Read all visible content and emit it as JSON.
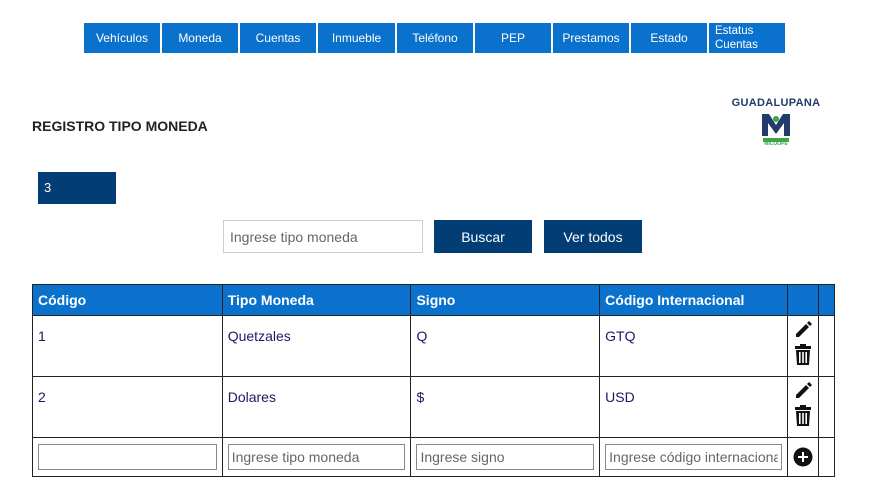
{
  "nav": {
    "items": [
      {
        "label": "Vehículos"
      },
      {
        "label": "Moneda"
      },
      {
        "label": "Cuentas"
      },
      {
        "label": "Inmueble"
      },
      {
        "label": "Teléfono"
      },
      {
        "label": "PEP"
      },
      {
        "label": "Prestamos"
      },
      {
        "label": "Estado"
      },
      {
        "label_line1": "Estatus",
        "label_line2": "Cuentas"
      }
    ]
  },
  "page": {
    "title": "REGISTRO TIPO MONEDA"
  },
  "logo": {
    "text": "GUADALUPANA",
    "subtext": "MICOOPE",
    "icon": "m-logo-icon"
  },
  "counter": {
    "value": "3"
  },
  "search": {
    "placeholder": "Ingrese tipo moneda",
    "button_label": "Buscar",
    "view_all_label": "Ver todos"
  },
  "table": {
    "headers": [
      "Código",
      "Tipo Moneda",
      "Signo",
      "Código Internacional"
    ],
    "rows": [
      {
        "codigo": "1",
        "tipo": "Quetzales",
        "signo": "Q",
        "internacional": "GTQ"
      },
      {
        "codigo": "2",
        "tipo": "Dolares",
        "signo": "$",
        "internacional": "USD"
      }
    ],
    "new_row": {
      "codigo_value": "",
      "tipo_placeholder": "Ingrese tipo moneda",
      "signo_placeholder": "Ingrese signo",
      "internacional_placeholder": "Ingrese código internaciona"
    }
  },
  "colors": {
    "nav": "#0a72cc",
    "primary": "#033d75",
    "header": "#0a72cc"
  }
}
